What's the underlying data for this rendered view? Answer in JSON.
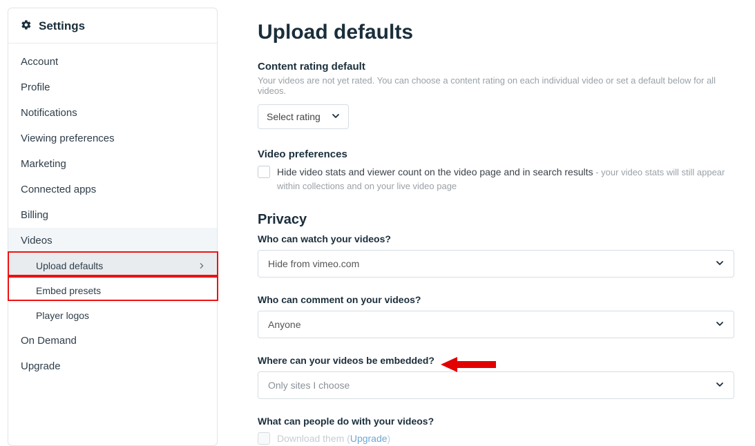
{
  "sidebar": {
    "title": "Settings",
    "items": [
      {
        "label": "Account"
      },
      {
        "label": "Profile"
      },
      {
        "label": "Notifications"
      },
      {
        "label": "Viewing preferences"
      },
      {
        "label": "Marketing"
      },
      {
        "label": "Connected apps"
      },
      {
        "label": "Billing"
      },
      {
        "label": "Videos",
        "expanded": true
      },
      {
        "label": "On Demand"
      },
      {
        "label": "Upgrade"
      }
    ],
    "videos_subnav": [
      {
        "label": "Upload defaults",
        "active": true
      },
      {
        "label": "Embed presets"
      },
      {
        "label": "Player logos"
      }
    ]
  },
  "main": {
    "title": "Upload defaults",
    "content_rating": {
      "label": "Content rating default",
      "desc": "Your videos are not yet rated. You can choose a content rating on each individual video or set a default below for all videos.",
      "select": "Select rating"
    },
    "video_prefs": {
      "label": "Video preferences",
      "chk_main": "Hide video stats and viewer count on the video page and in search results",
      "chk_muted": " - your video stats will still appear within collections and on your live video page"
    },
    "privacy": {
      "title": "Privacy",
      "watch": {
        "q": "Who can watch your videos?",
        "val": "Hide from vimeo.com"
      },
      "comment": {
        "q": "Who can comment on your videos?",
        "val": "Anyone"
      },
      "embed": {
        "q": "Where can your videos be embedded?",
        "val": "Only sites I choose"
      },
      "do": {
        "q": "What can people do with your videos?",
        "dl_text": "Download them (",
        "dl_link": "Upgrade",
        "dl_close": ")"
      }
    }
  }
}
